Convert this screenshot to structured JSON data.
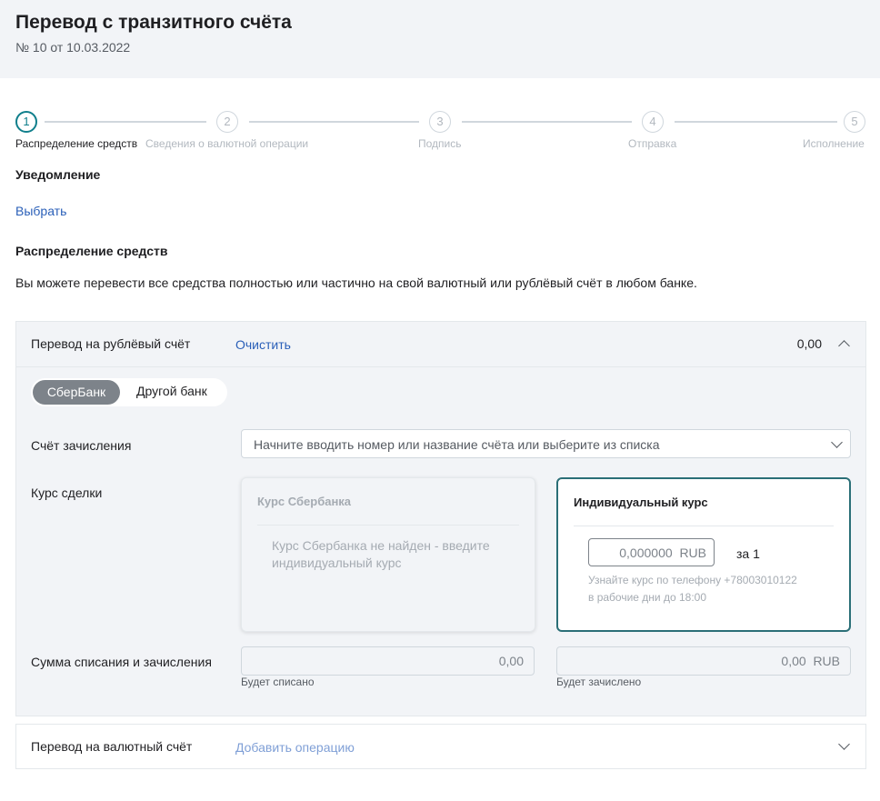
{
  "header": {
    "title": "Перевод с транзитного счёта",
    "subtitle": "№ 10 от 10.03.2022"
  },
  "stepper": {
    "steps": [
      {
        "number": "1",
        "label": "Распределение средств",
        "active": true
      },
      {
        "number": "2",
        "label": "Сведения о валютной операции",
        "active": false
      },
      {
        "number": "3",
        "label": "Подпись",
        "active": false
      },
      {
        "number": "4",
        "label": "Отправка",
        "active": false
      },
      {
        "number": "5",
        "label": "Исполнение",
        "active": false
      }
    ]
  },
  "notification": {
    "title": "Уведомление",
    "select_link": "Выбрать"
  },
  "distribution": {
    "title": "Распределение средств",
    "description": "Вы можете перевести все средства полностью или частично на свой валютный или рублёвый счёт в любом банке."
  },
  "rub_transfer": {
    "title": "Перевод на рублёвый счёт",
    "clear_link": "Очистить",
    "amount": "0,00",
    "bank_toggle": {
      "selected": "СберБанк",
      "other": "Другой банк"
    },
    "account_label": "Счёт зачисления",
    "account_placeholder": "Начните вводить номер или название счёта или выберите из списка",
    "rate_label": "Курс сделки",
    "sber_rate_card": {
      "title": "Курс Сбербанка",
      "message": "Курс Сбербанка не найден - введите индивидуальный курс"
    },
    "individual_rate_card": {
      "title": "Индивидуальный курс",
      "rate_value": "0,000000",
      "rate_currency": "RUB",
      "per_unit": "за 1",
      "hint_line1": "Узнайте курс по телефону +78003010122",
      "hint_line2": "в рабочие дни до 18:00"
    },
    "sum_label": "Сумма списания и зачисления",
    "debit_value": "0,00",
    "debit_caption": "Будет списано",
    "credit_value": "0,00",
    "credit_currency": "RUB",
    "credit_caption": "Будет зачислено"
  },
  "fx_transfer": {
    "title": "Перевод на валютный счёт",
    "add_link": "Добавить операцию"
  },
  "colors": {
    "accent_teal": "#107f8c",
    "link_blue": "#2a5fb8",
    "panel_bg": "#f2f4f7"
  }
}
